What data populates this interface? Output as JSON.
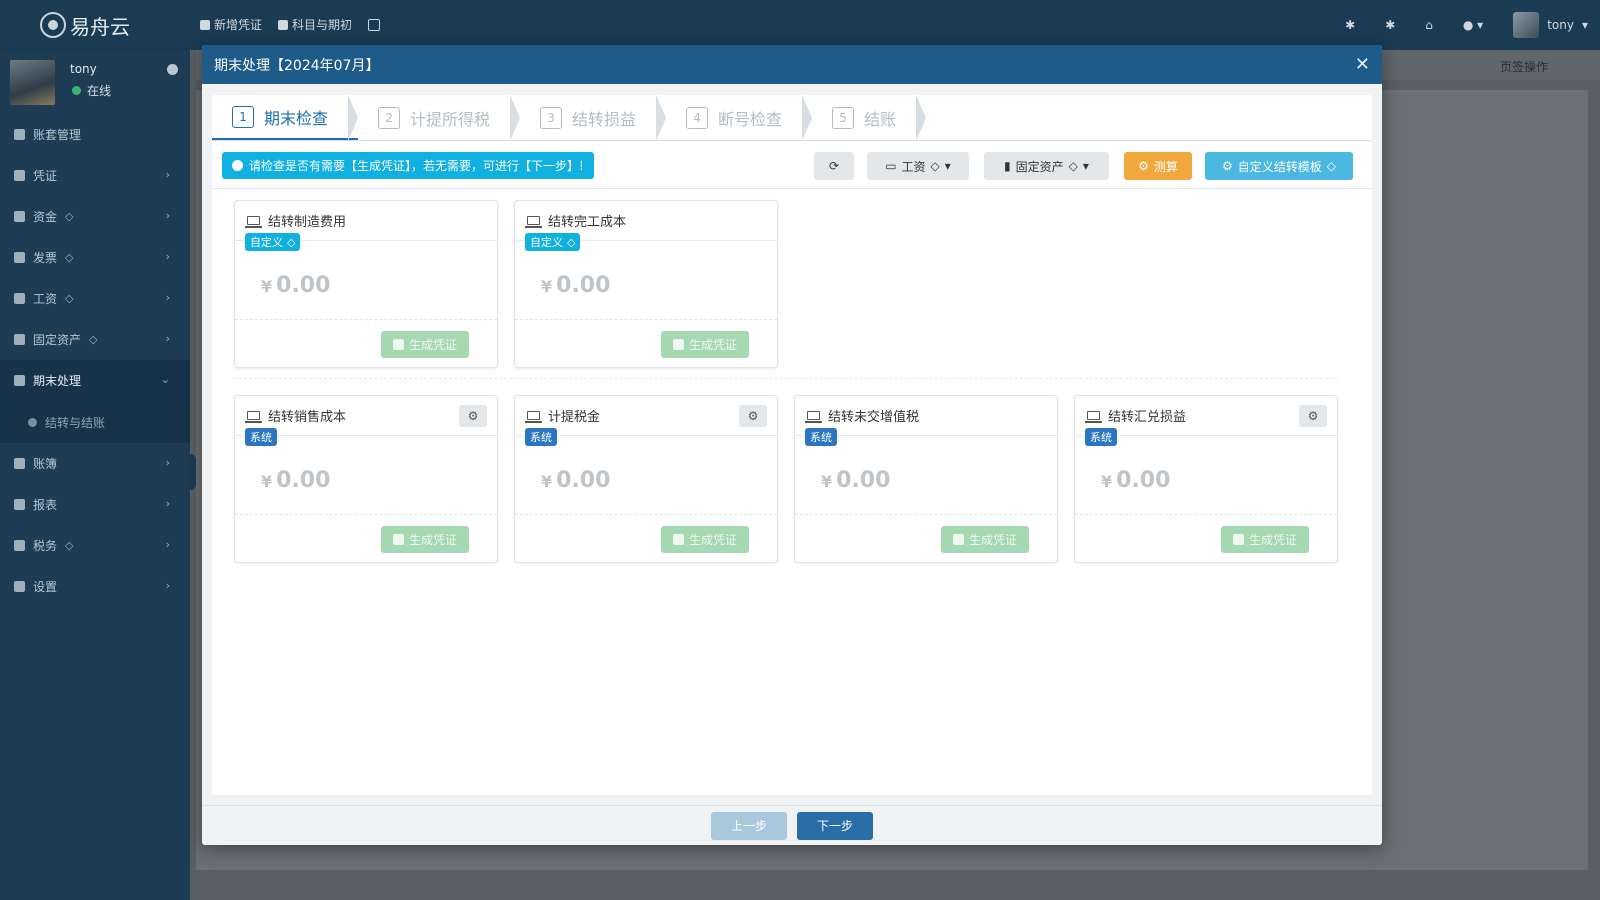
{
  "app": {
    "logo_text": "易舟云"
  },
  "topnav": [
    {
      "label": "新增凭证"
    },
    {
      "label": "科目与期初"
    }
  ],
  "topright": {
    "user_name": "tony"
  },
  "sidebar": {
    "user": {
      "name": "tony",
      "status": "在线"
    },
    "items": [
      {
        "label": "账套管理",
        "gem": false,
        "chevron": false
      },
      {
        "label": "凭证",
        "gem": false,
        "chevron": true
      },
      {
        "label": "资金",
        "gem": true,
        "chevron": true
      },
      {
        "label": "发票",
        "gem": true,
        "chevron": true
      },
      {
        "label": "工资",
        "gem": true,
        "chevron": true
      },
      {
        "label": "固定资产",
        "gem": true,
        "chevron": true
      },
      {
        "label": "期末处理",
        "gem": false,
        "chevron": true,
        "expanded": true
      },
      {
        "label": "账簿",
        "gem": false,
        "chevron": true
      },
      {
        "label": "报表",
        "gem": false,
        "chevron": true
      },
      {
        "label": "税务",
        "gem": true,
        "chevron": true
      },
      {
        "label": "设置",
        "gem": false,
        "chevron": true
      }
    ],
    "sub_item": "结转与结账"
  },
  "background": {
    "page_ops": "页签操作"
  },
  "modal": {
    "title": "期末处理【2024年07月】",
    "close_icon": "close-icon",
    "steps": [
      {
        "num": "1",
        "label": "期末检查"
      },
      {
        "num": "2",
        "label": "计提所得税"
      },
      {
        "num": "3",
        "label": "结转损益"
      },
      {
        "num": "4",
        "label": "断号检查"
      },
      {
        "num": "5",
        "label": "结账"
      }
    ],
    "tip": "请检查是否有需要【生成凭证】，若无需要，可进行【下一步】!",
    "toolbar": {
      "salary": "工资",
      "fixed_assets": "固定资产",
      "calculate": "测算",
      "custom_template": "自定义结转模板"
    },
    "cards_custom": [
      {
        "title": "结转制造费用",
        "badge": "自定义",
        "amount": "0.00",
        "button": "生成凭证"
      },
      {
        "title": "结转完工成本",
        "badge": "自定义",
        "amount": "0.00",
        "button": "生成凭证"
      }
    ],
    "cards_system": [
      {
        "title": "结转销售成本",
        "badge": "系统",
        "amount": "0.00",
        "button": "生成凭证"
      },
      {
        "title": "计提税金",
        "badge": "系统",
        "amount": "0.00",
        "button": "生成凭证"
      },
      {
        "title": "结转未交增值税",
        "badge": "系统",
        "amount": "0.00",
        "button": "生成凭证"
      },
      {
        "title": "结转汇兑损益",
        "badge": "系统",
        "amount": "0.00",
        "button": "生成凭证"
      }
    ],
    "currency_symbol": "¥",
    "footer": {
      "prev": "上一步",
      "next": "下一步"
    }
  }
}
